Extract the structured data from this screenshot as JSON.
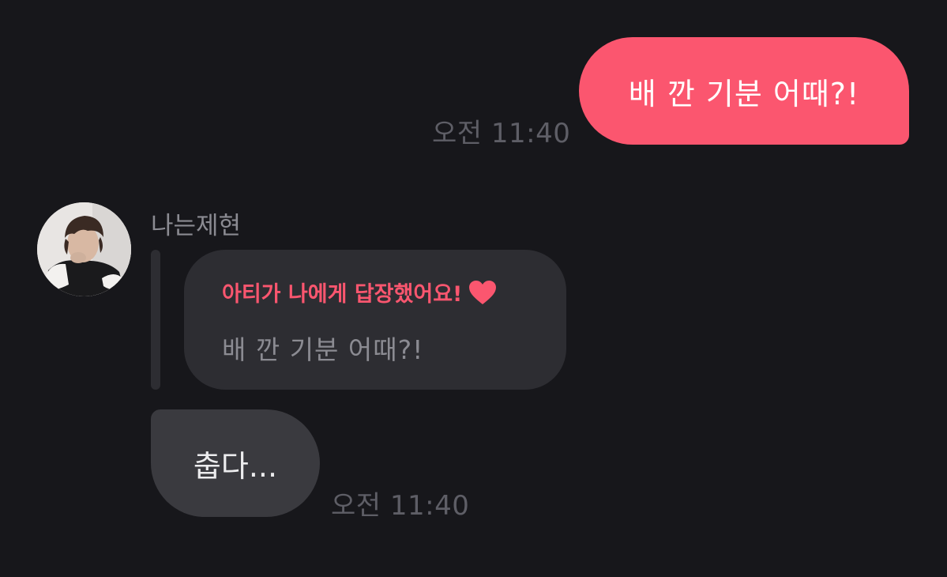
{
  "outgoing": {
    "text": "배 깐 기분 어때?!",
    "time": "오전 11:40"
  },
  "incoming": {
    "sender_name": "나는제현",
    "avatar_icon": "profile-photo",
    "reply_title": "아티가 나에게 답장했어요!",
    "reply_heart_icon": "heart-icon",
    "reply_quote": "배 깐 기분 어때?!",
    "text": "춥다...",
    "time": "오전 11:40"
  },
  "colors": {
    "background": "#17171b",
    "accent": "#fb566f",
    "incoming_bubble": "#3a3a3f",
    "reply_bubble": "#2d2d32",
    "muted_text": "#5e5e66"
  }
}
